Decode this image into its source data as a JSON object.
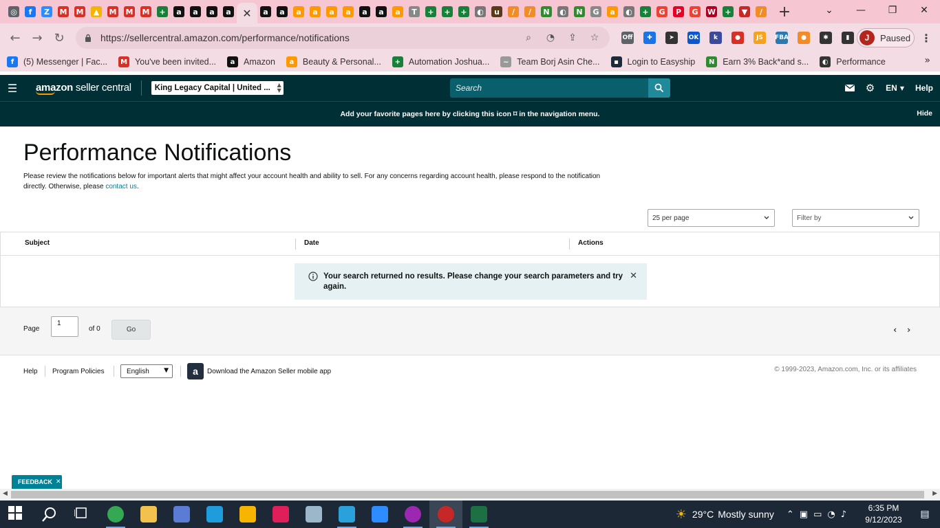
{
  "browser": {
    "tabs": [
      {
        "icon": "chrome-icon",
        "glyph": "◎",
        "color": "#5f6368"
      },
      {
        "icon": "facebook-icon",
        "glyph": "f",
        "color": "#1877f2"
      },
      {
        "icon": "zoom-icon",
        "glyph": "Z",
        "color": "#2d8cff"
      },
      {
        "icon": "gmail-icon",
        "glyph": "M",
        "color": "#d93025"
      },
      {
        "icon": "gmail-icon",
        "glyph": "M",
        "color": "#d93025"
      },
      {
        "icon": "google-drive-icon",
        "glyph": "▲",
        "color": "#f4b400"
      },
      {
        "icon": "gmail-icon",
        "glyph": "M",
        "color": "#d93025"
      },
      {
        "icon": "gmail-icon",
        "glyph": "M",
        "color": "#d93025"
      },
      {
        "icon": "gmail-icon",
        "glyph": "M",
        "color": "#d93025"
      },
      {
        "icon": "sheets-icon",
        "glyph": "+",
        "color": "#188038"
      },
      {
        "icon": "amazon-icon",
        "glyph": "a",
        "color": "#111111"
      },
      {
        "icon": "amazon-icon",
        "glyph": "a",
        "color": "#111111"
      },
      {
        "icon": "amazon-icon",
        "glyph": "a",
        "color": "#111111"
      },
      {
        "icon": "amazon-icon",
        "glyph": "a",
        "color": "#111111"
      },
      {
        "icon": "close-icon",
        "glyph": "✕",
        "color": "",
        "active": true
      },
      {
        "icon": "amazon-icon",
        "glyph": "a",
        "color": "#111111"
      },
      {
        "icon": "amazon-icon",
        "glyph": "a",
        "color": "#111111"
      },
      {
        "icon": "amazon-smile-icon",
        "glyph": "a",
        "color": "#ff9900"
      },
      {
        "icon": "amazon-smile-icon",
        "glyph": "a",
        "color": "#ff9900"
      },
      {
        "icon": "amazon-smile-icon",
        "glyph": "a",
        "color": "#ff9900"
      },
      {
        "icon": "amazon-smile-icon",
        "glyph": "a",
        "color": "#ff9900"
      },
      {
        "icon": "amazon-icon",
        "glyph": "a",
        "color": "#111111"
      },
      {
        "icon": "amazon-icon",
        "glyph": "a",
        "color": "#111111"
      },
      {
        "icon": "amazon-smile-icon",
        "glyph": "a",
        "color": "#ff9900"
      },
      {
        "icon": "script-icon",
        "glyph": "T",
        "color": "#888888"
      },
      {
        "icon": "sheets-icon",
        "glyph": "+",
        "color": "#188038"
      },
      {
        "icon": "sheets-icon",
        "glyph": "+",
        "color": "#188038"
      },
      {
        "icon": "sheets-icon",
        "glyph": "+",
        "color": "#188038"
      },
      {
        "icon": "globe-icon",
        "glyph": "◐",
        "color": "#777777"
      },
      {
        "icon": "ups-icon",
        "glyph": "u",
        "color": "#5a3a1a"
      },
      {
        "icon": "pen-icon",
        "glyph": "/",
        "color": "#f28c28"
      },
      {
        "icon": "pen-icon",
        "glyph": "/",
        "color": "#f28c28"
      },
      {
        "icon": "vine-icon",
        "glyph": "N",
        "color": "#2e8b2e"
      },
      {
        "icon": "globe-icon",
        "glyph": "◐",
        "color": "#777777"
      },
      {
        "icon": "vine-icon",
        "glyph": "N",
        "color": "#2e8b2e"
      },
      {
        "icon": "google-icon",
        "glyph": "G",
        "color": "#888888"
      },
      {
        "icon": "amazon-smile-icon",
        "glyph": "a",
        "color": "#ff9900"
      },
      {
        "icon": "globe-icon",
        "glyph": "◐",
        "color": "#777777"
      },
      {
        "icon": "sheets-icon",
        "glyph": "+",
        "color": "#188038"
      },
      {
        "icon": "google-icon",
        "glyph": "G",
        "color": "#ea4335"
      },
      {
        "icon": "pinterest-icon",
        "glyph": "P",
        "color": "#e60023"
      },
      {
        "icon": "google-icon",
        "glyph": "G",
        "color": "#ea4335"
      },
      {
        "icon": "walgreens-icon",
        "glyph": "W",
        "color": "#b00020"
      },
      {
        "icon": "sheets-icon",
        "glyph": "+",
        "color": "#188038"
      },
      {
        "icon": "filter-icon",
        "glyph": "▼",
        "color": "#c62828"
      },
      {
        "icon": "pen-icon",
        "glyph": "/",
        "color": "#f28c28"
      }
    ],
    "url": "https://sellercentral.amazon.com/performance/notifications",
    "profile_initial": "J",
    "profile_status": "Paused",
    "extensions": [
      {
        "icon": "off-extension-icon",
        "glyph": "Off",
        "color": "#5f6368"
      },
      {
        "icon": "puzzle-blue-icon",
        "glyph": "✚",
        "color": "#1a73e8"
      },
      {
        "icon": "cursor-icon",
        "glyph": "➤",
        "color": "#333333"
      },
      {
        "icon": "ok-extension-icon",
        "glyph": "OK",
        "color": "#0b57d0"
      },
      {
        "icon": "keepa-icon",
        "glyph": "k",
        "color": "#3b4a9c"
      },
      {
        "icon": "pokeball-icon",
        "glyph": "●",
        "color": "#d93025"
      },
      {
        "icon": "js-icon",
        "glyph": "JS",
        "color": "#f7a21b"
      },
      {
        "icon": "fba-icon",
        "glyph": "FBA",
        "color": "#2a7ab0"
      },
      {
        "icon": "orange-circle-icon",
        "glyph": "●",
        "color": "#f28c28"
      },
      {
        "icon": "extensions-puzzle-icon",
        "glyph": "✱",
        "color": "#333333"
      },
      {
        "icon": "sidebar-icon",
        "glyph": "▮",
        "color": "#333333"
      }
    ],
    "bookmarks": [
      {
        "icon": "facebook-icon",
        "glyph": "f",
        "color": "#1877f2",
        "label": "(5) Messenger | Fac..."
      },
      {
        "icon": "gmail-icon",
        "glyph": "M",
        "color": "#d93025",
        "label": "You've been invited..."
      },
      {
        "icon": "amazon-icon",
        "glyph": "a",
        "color": "#111111",
        "label": "Amazon"
      },
      {
        "icon": "amazon-smile-icon",
        "glyph": "a",
        "color": "#ff9900",
        "label": "Beauty & Personal..."
      },
      {
        "icon": "sheets-icon",
        "glyph": "+",
        "color": "#188038",
        "label": "Automation Joshua..."
      },
      {
        "icon": "signature-icon",
        "glyph": "~",
        "color": "#999999",
        "label": "Team Borj Asin Che..."
      },
      {
        "icon": "cube-icon",
        "glyph": "▪",
        "color": "#1c2a3a",
        "label": "Login to Easyship"
      },
      {
        "icon": "vine-icon",
        "glyph": "N",
        "color": "#2e8b2e",
        "label": "Earn 3% Back*and s..."
      },
      {
        "icon": "globe-icon",
        "glyph": "◐",
        "color": "#333333",
        "label": "Performance"
      }
    ]
  },
  "header": {
    "logo_main": "amazon",
    "logo_sub": " seller central",
    "account": "King Legacy Capital | United ...",
    "search_placeholder": "Search",
    "language": "EN",
    "help": "Help"
  },
  "banner": {
    "text": "Add your favorite pages here by clicking this icon ⌑ in the navigation menu.",
    "hide": "Hide"
  },
  "main": {
    "title": "Performance Notifications",
    "intro": "Please review the notifications below for important alerts that might affect your account health and ability to sell. For any concerns regarding account health, please respond to the notification directly. Otherwise, please ",
    "intro_link": "contact us",
    "intro_end": ".",
    "per_page": "25 per page",
    "filter": "Filter by",
    "columns": {
      "subject": "Subject",
      "date": "Date",
      "actions": "Actions"
    },
    "alert": "Your search returned no results. Please change your search parameters and try again.",
    "pager": {
      "page_label": "Page",
      "page_value": "1",
      "of_label": "of 0",
      "go": "Go"
    }
  },
  "footer": {
    "help": "Help",
    "policies": "Program Policies",
    "language": "English",
    "app": "Download the Amazon Seller mobile app",
    "copyright": "© 1999-2023, Amazon.com, Inc. or its affiliates"
  },
  "feedback": "FEEDBACK",
  "taskbar": {
    "apps": [
      {
        "icon": "windows-start-icon",
        "color": "#ffffff"
      },
      {
        "icon": "search-icon",
        "color": "#ffffff"
      },
      {
        "icon": "task-view-icon",
        "color": "#ffffff"
      },
      {
        "icon": "chrome-icon",
        "color": "#34a853",
        "open": true
      },
      {
        "icon": "file-explorer-icon",
        "color": "#f2c14e"
      },
      {
        "icon": "screen-app-icon",
        "color": "#5b7bd5"
      },
      {
        "icon": "edge-icon",
        "color": "#1f9cdb"
      },
      {
        "icon": "shield-app-icon",
        "color": "#f7b500"
      },
      {
        "icon": "slack-icon",
        "color": "#e01e5a"
      },
      {
        "icon": "notes-app-icon",
        "color": "#9bb7c9"
      },
      {
        "icon": "telegram-icon",
        "color": "#2aa1da",
        "open": true
      },
      {
        "icon": "zoom-icon",
        "color": "#2d8cff"
      },
      {
        "icon": "chrome-profile-icon",
        "color": "#9c27b0",
        "open": true
      },
      {
        "icon": "chrome-profile-icon",
        "color": "#c62828",
        "open": true,
        "current": true
      },
      {
        "icon": "excel-icon",
        "color": "#1d7044",
        "open": true
      }
    ],
    "weather_temp": "29°C",
    "weather_text": "Mostly sunny",
    "time": "6:35 PM",
    "date": "9/12/2023"
  }
}
